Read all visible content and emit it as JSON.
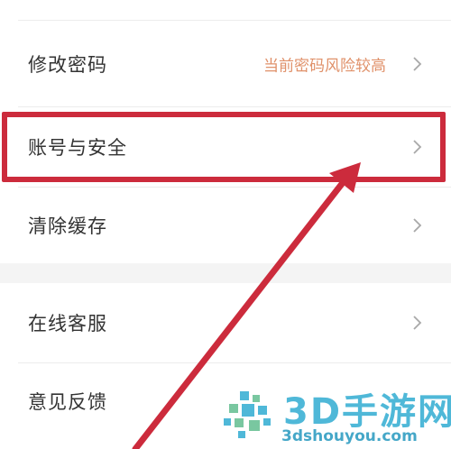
{
  "settings": {
    "items": [
      {
        "label": "修改密码",
        "hint": "当前密码风险较高"
      },
      {
        "label": "账号与安全"
      },
      {
        "label": "清除缓存"
      },
      {
        "label": "在线客服"
      },
      {
        "label": "意见反馈"
      }
    ]
  },
  "icons": {
    "chevron": "chevron-right-icon"
  },
  "colors": {
    "highlight": "#cc2b3c",
    "hint": "#e0916a",
    "watermark": "#4fb8d8"
  },
  "watermark": {
    "title": "3D手游网",
    "url": "3dshouyou.com"
  }
}
